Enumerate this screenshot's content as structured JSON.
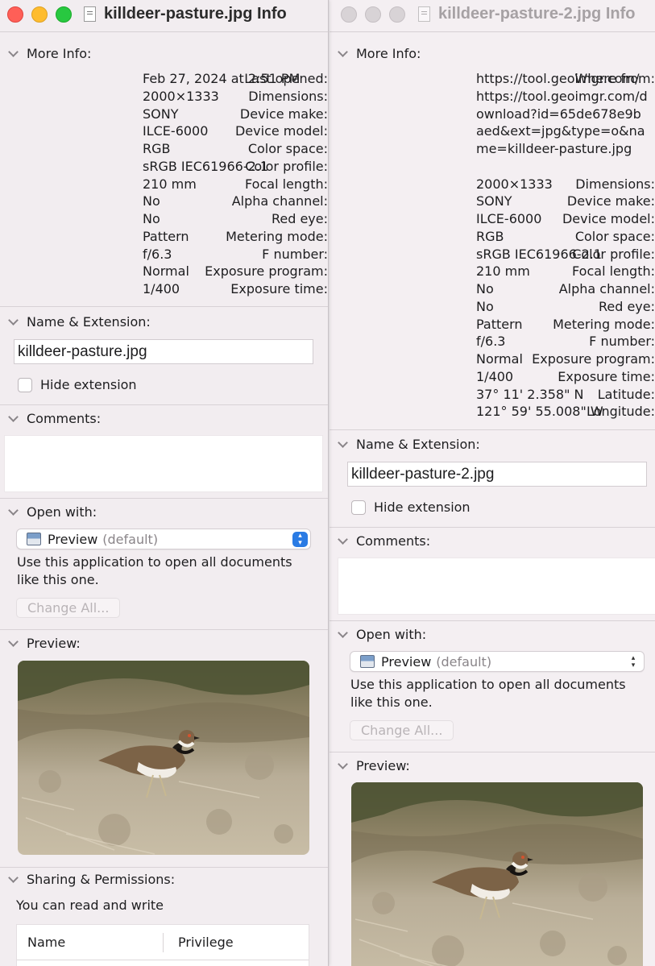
{
  "left": {
    "title": "killdeer-pasture.jpg Info",
    "more_info_label": "More Info:",
    "info": [
      {
        "k": "Last opened:",
        "v": "Feb 27, 2024 at 2:51 PM"
      },
      {
        "k": "Dimensions:",
        "v": "2000×1333"
      },
      {
        "k": "Device make:",
        "v": "SONY"
      },
      {
        "k": "Device model:",
        "v": "ILCE-6000"
      },
      {
        "k": "Color space:",
        "v": "RGB"
      },
      {
        "k": "Color profile:",
        "v": "sRGB IEC61966-2.1"
      },
      {
        "k": "Focal length:",
        "v": "210 mm"
      },
      {
        "k": "Alpha channel:",
        "v": "No"
      },
      {
        "k": "Red eye:",
        "v": "No"
      },
      {
        "k": "Metering mode:",
        "v": "Pattern"
      },
      {
        "k": "F number:",
        "v": "f/6.3"
      },
      {
        "k": "Exposure program:",
        "v": "Normal"
      },
      {
        "k": "Exposure time:",
        "v": "1/400"
      }
    ],
    "name_ext_label": "Name & Extension:",
    "filename": "killdeer-pasture.jpg",
    "hide_extension_label": "Hide extension",
    "comments_label": "Comments:",
    "open_with_label": "Open with:",
    "app_name": "Preview",
    "app_default": "(default)",
    "open_with_desc_1": "Use this application to open all documents",
    "open_with_desc_2": "like this one.",
    "change_all_label": "Change All...",
    "preview_label": "Preview:",
    "sharing_label": "Sharing & Permissions:",
    "sharing_desc": "You can read and write",
    "perm_col_name": "Name",
    "perm_col_priv": "Privilege"
  },
  "right": {
    "title": "killdeer-pasture-2.jpg Info",
    "more_info_label": "More Info:",
    "where_from_key": "Where from:",
    "where_from_1": "https://tool.geoimgr.com/",
    "where_from_2": "https://tool.geoimgr.com/download?id=65de678e9baed&ext=jpg&type=o&name=killdeer-pasture.jpg",
    "info": [
      {
        "k": "Dimensions:",
        "v": "2000×1333"
      },
      {
        "k": "Device make:",
        "v": "SONY"
      },
      {
        "k": "Device model:",
        "v": "ILCE-6000"
      },
      {
        "k": "Color space:",
        "v": "RGB"
      },
      {
        "k": "Color profile:",
        "v": "sRGB IEC61966-2.1"
      },
      {
        "k": "Focal length:",
        "v": "210 mm"
      },
      {
        "k": "Alpha channel:",
        "v": "No"
      },
      {
        "k": "Red eye:",
        "v": "No"
      },
      {
        "k": "Metering mode:",
        "v": "Pattern"
      },
      {
        "k": "F number:",
        "v": "f/6.3"
      },
      {
        "k": "Exposure program:",
        "v": "Normal"
      },
      {
        "k": "Exposure time:",
        "v": "1/400"
      },
      {
        "k": "Latitude:",
        "v": "37° 11' 2.358\" N"
      },
      {
        "k": "Longitude:",
        "v": "121° 59' 55.008\" W"
      }
    ],
    "name_ext_label": "Name & Extension:",
    "filename": "killdeer-pasture-2.jpg",
    "hide_extension_label": "Hide extension",
    "comments_label": "Comments:",
    "open_with_label": "Open with:",
    "app_name": "Preview",
    "app_default": "(default)",
    "open_with_desc_1": "Use this application to open all documents",
    "open_with_desc_2": "like this one.",
    "change_all_label": "Change All...",
    "preview_label": "Preview:"
  },
  "colors": {
    "window_bg": "#f2edf0",
    "close": "#ff5f57",
    "minimize": "#febc2e",
    "zoom": "#28c840",
    "accent": "#2a7be4"
  }
}
